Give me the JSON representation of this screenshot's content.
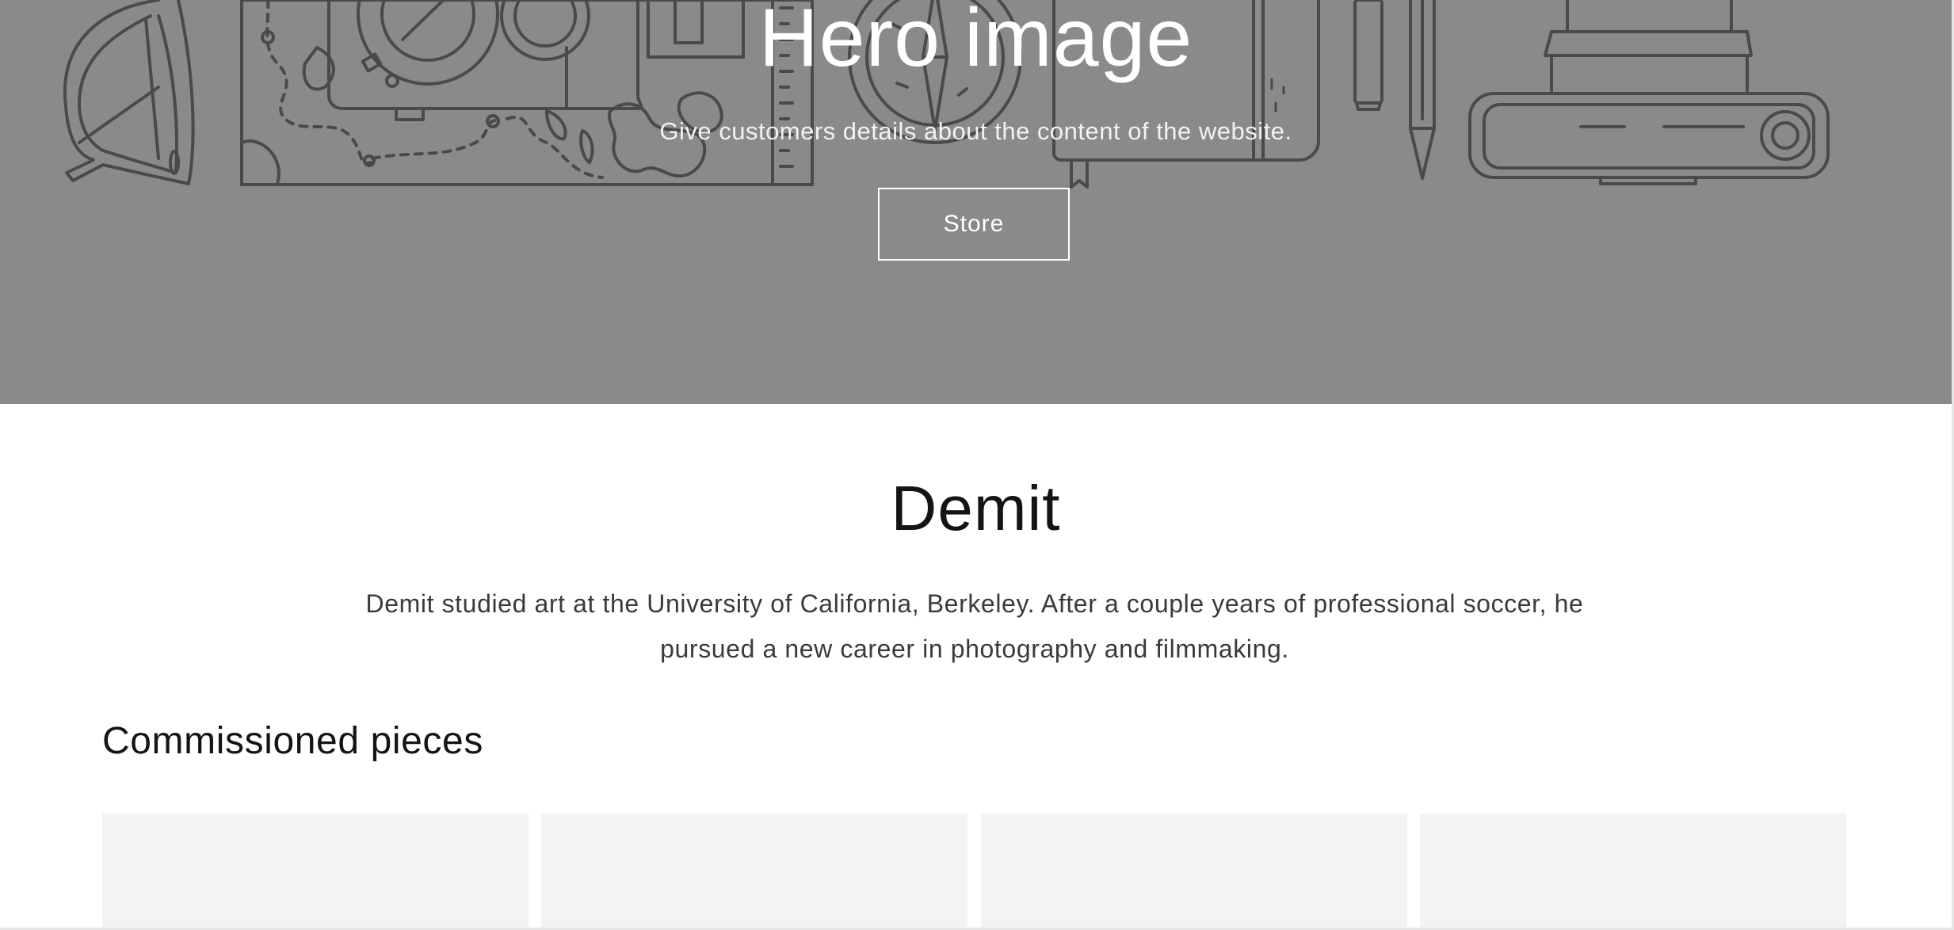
{
  "hero": {
    "title": "Hero image",
    "subtitle": "Give customers details about the content of the website.",
    "button_label": "Store",
    "background_color": "#8a8a8a",
    "illustration_icons": [
      "sunglasses-icon",
      "map-icon",
      "camera-icon",
      "compass-icon",
      "notebook-icon",
      "pencil-icon",
      "film-camera-icon"
    ]
  },
  "about": {
    "title": "Demit",
    "text": "Demit studied art at the University of California, Berkeley. After a couple years of professional soccer, he pursued a new career in photography and filmmaking."
  },
  "collection": {
    "heading": "Commissioned pieces",
    "card_count": 4,
    "card_color": "#f3f3f3"
  }
}
